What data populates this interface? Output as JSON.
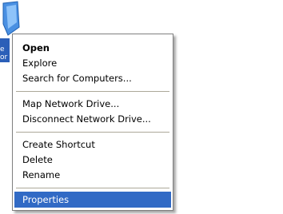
{
  "desktop_icon": {
    "label_fragments": [
      "e",
      "or"
    ]
  },
  "context_menu": {
    "items": [
      {
        "label": "Open",
        "bold": true
      },
      {
        "label": "Explore"
      },
      {
        "label": "Search for Computers..."
      },
      {
        "label": "Map Network Drive..."
      },
      {
        "label": "Disconnect Network Drive..."
      },
      {
        "label": "Create Shortcut"
      },
      {
        "label": "Delete"
      },
      {
        "label": "Rename"
      },
      {
        "label": "Properties",
        "highlighted": true
      }
    ]
  },
  "colors": {
    "highlight": "#316ac5",
    "separator": "#aca899",
    "menu_border": "#808080"
  }
}
